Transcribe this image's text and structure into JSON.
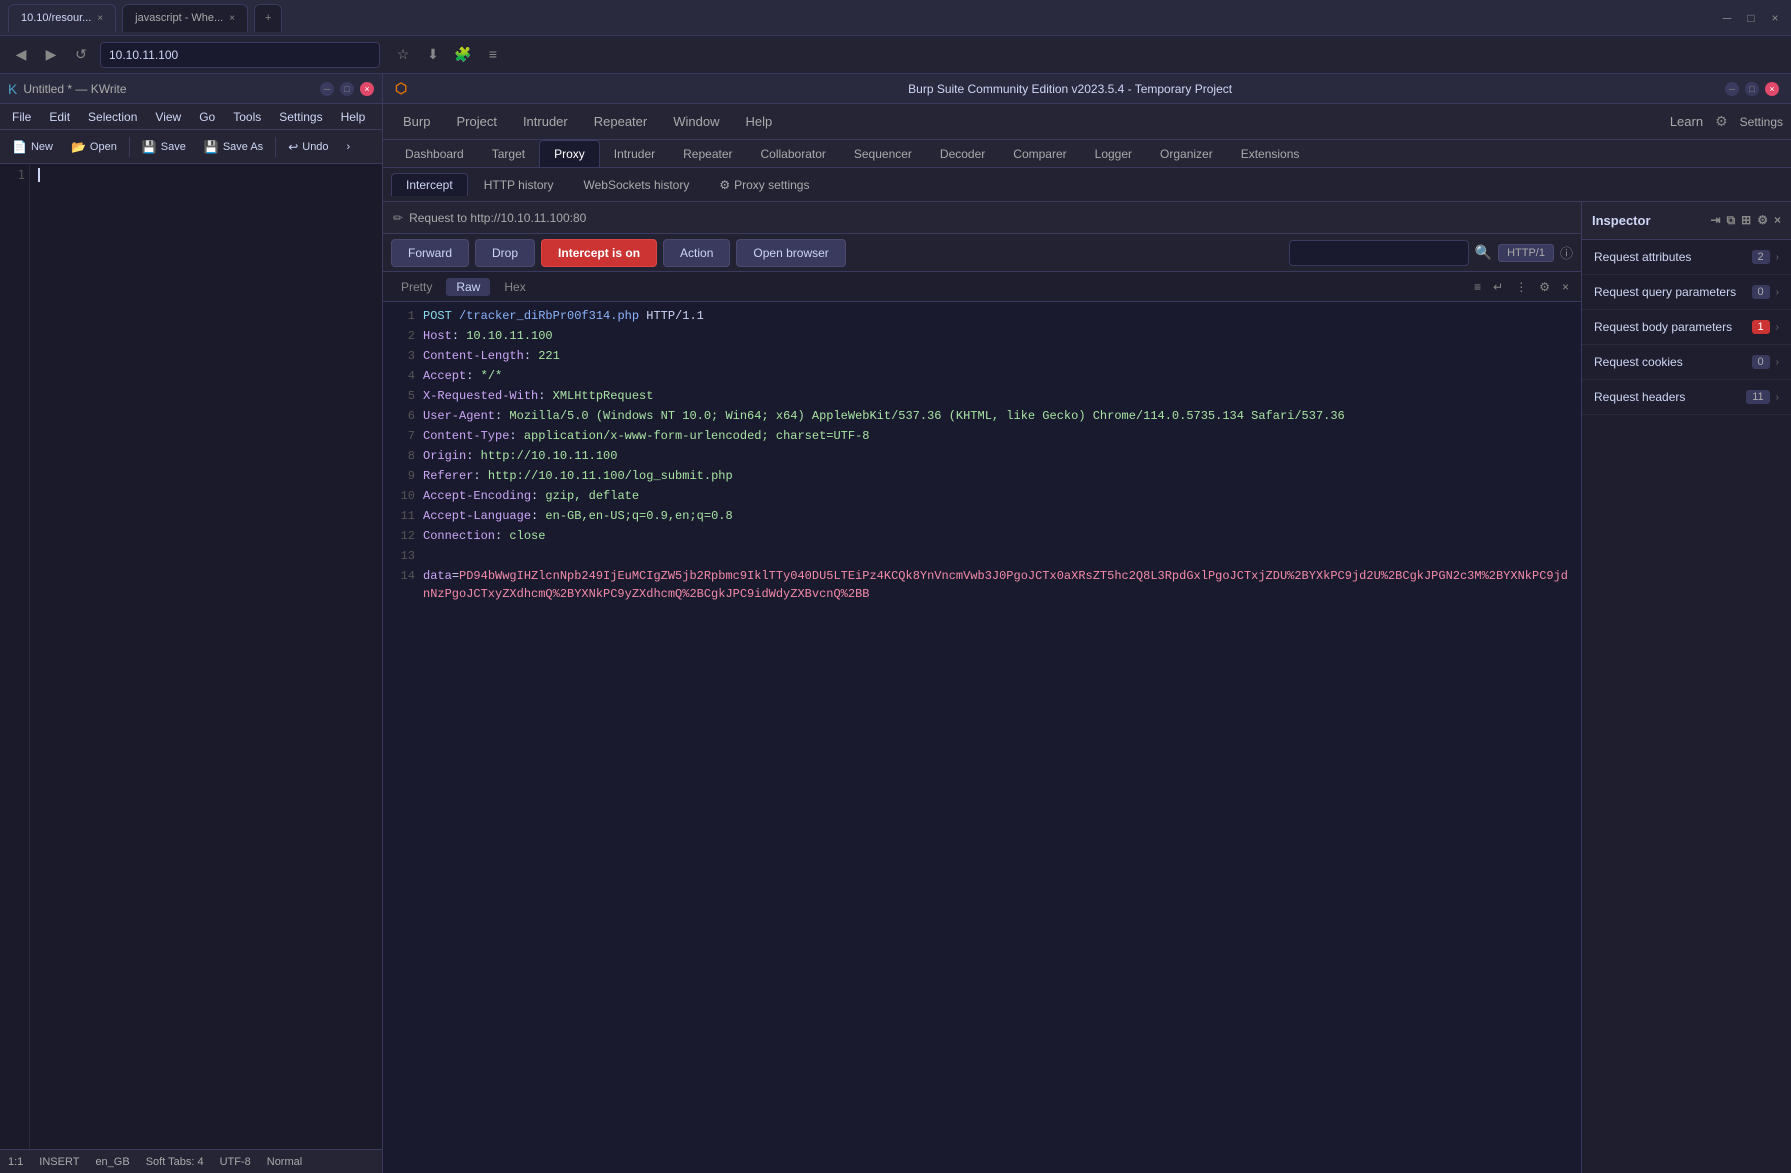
{
  "window": {
    "title": "Burp Suite Community Edition v2023.5.4 - Temporary Project",
    "browser_tab1": "10.10/resour...",
    "browser_tab2": "javascript - Whe...",
    "address": "10.10.11.100"
  },
  "kwrite": {
    "title": "Untitled * — KWrite",
    "menu": [
      "File",
      "Edit",
      "Selection",
      "View",
      "Go",
      "Tools",
      "Settings",
      "Help"
    ],
    "toolbar": [
      "New",
      "Open",
      "Save",
      "Save As",
      "Undo"
    ],
    "editor_content": "",
    "line_number": "1",
    "status": {
      "position": "1:1",
      "mode": "INSERT",
      "encoding": "en_GB",
      "tab": "Soft Tabs: 4",
      "charset": "UTF-8",
      "normal": "Normal"
    }
  },
  "burp": {
    "title": "Burp Suite Community Edition v2023.5.4 - Temporary Project",
    "nav": [
      "Burp",
      "Project",
      "Intruder",
      "Repeater",
      "Window",
      "Help"
    ],
    "nav_tabs": [
      "Dashboard",
      "Target",
      "Proxy",
      "Intruder",
      "Repeater",
      "Collaborator",
      "Sequencer",
      "Decoder",
      "Comparer",
      "Logger",
      "Organizer",
      "Extensions"
    ],
    "nav_active": "Proxy",
    "nav_right": [
      "Learn",
      "Settings"
    ],
    "proxy_tabs": [
      "Intercept",
      "HTTP history",
      "WebSockets history",
      "Proxy settings"
    ],
    "proxy_active": "Intercept",
    "request_url": "Request to http://10.10.11.100:80",
    "toolbar_btns": {
      "forward": "Forward",
      "drop": "Drop",
      "intercept": "Intercept is on",
      "action": "Action",
      "open_browser": "Open browser"
    },
    "search_placeholder": "",
    "http_version": "HTTP/1",
    "view_tabs": [
      "Pretty",
      "Raw",
      "Hex"
    ],
    "view_active": "Raw",
    "request_lines": [
      {
        "num": 1,
        "content": "POST /tracker_diRbPr00f314.php HTTP/1.1"
      },
      {
        "num": 2,
        "content": "Host: 10.10.11.100"
      },
      {
        "num": 3,
        "content": "Content-Length: 221"
      },
      {
        "num": 4,
        "content": "Accept: */*"
      },
      {
        "num": 5,
        "content": "X-Requested-With: XMLHttpRequest"
      },
      {
        "num": 6,
        "content": "User-Agent: Mozilla/5.0 (Windows NT 10.0; Win64; x64) AppleWebKit/537.36 (KHTML, like Gecko) Chrome/114.0.5735.134 Safari/537.36"
      },
      {
        "num": 7,
        "content": "Content-Type: application/x-www-form-urlencoded; charset=UTF-8"
      },
      {
        "num": 8,
        "content": "Origin: http://10.10.11.100"
      },
      {
        "num": 9,
        "content": "Referer: http://10.10.11.100/log_submit.php"
      },
      {
        "num": 10,
        "content": "Accept-Encoding: gzip, deflate"
      },
      {
        "num": 11,
        "content": "Accept-Language: en-GB,en-US;q=0.9,en;q=0.8"
      },
      {
        "num": 12,
        "content": "Connection: close"
      },
      {
        "num": 13,
        "content": ""
      },
      {
        "num": 14,
        "content": "data=PD94bWwgIHZlcnNpb249IjEuMCIgZW5jb2Rpbmc9IklTTy040DU5LTEiPz4KCQk8YnVncmVwb3J0PgoJCTx0aXRsZT5hc2Q8L3RpdGxlPgoJCTxjZDU%2BYXkPC9jd2U%2BCgkJPGN2c3M%2BYXNkPC9jdnNzPgoJCTxyZXdhcmQ%2BYXNkPC9yZXdhcmQ%2BCgkJPC9idWdyZXBvcnQ%2BB"
      }
    ],
    "inspector": {
      "title": "Inspector",
      "items": [
        {
          "label": "Request attributes",
          "count": 2
        },
        {
          "label": "Request query parameters",
          "count": 0
        },
        {
          "label": "Request body parameters",
          "count": 1,
          "accent": true
        },
        {
          "label": "Request cookies",
          "count": 0
        },
        {
          "label": "Request headers",
          "count": 11
        }
      ]
    }
  }
}
